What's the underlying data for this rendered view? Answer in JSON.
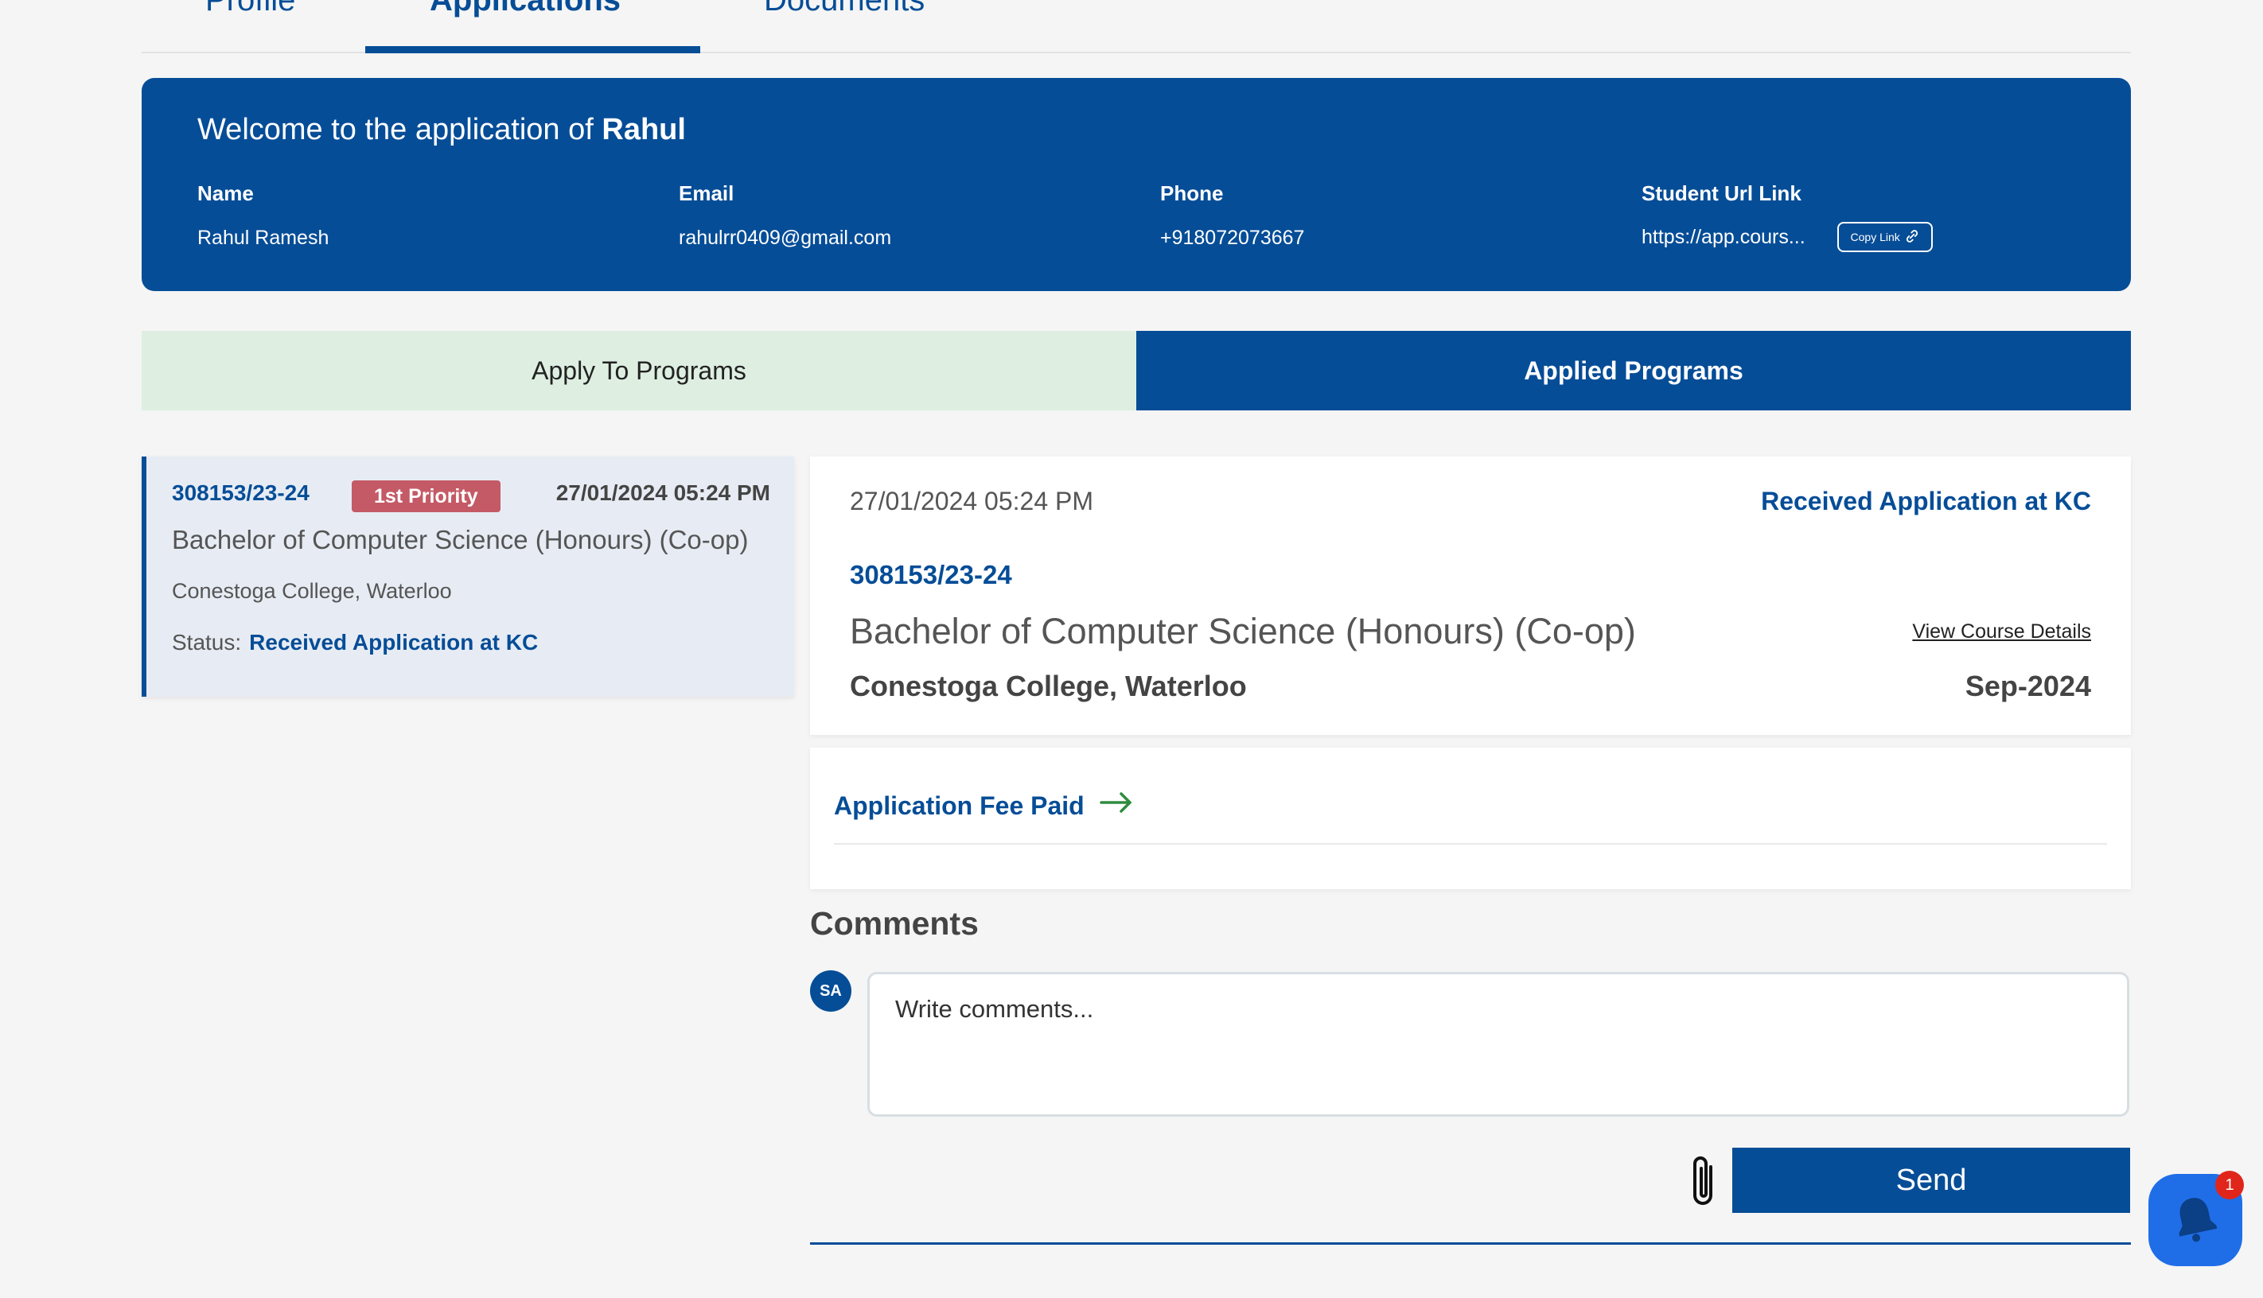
{
  "top_tabs": {
    "profile": "Profile",
    "applications": "Applications",
    "documents": "Documents",
    "active": "applications"
  },
  "welcome": {
    "prefix": "Welcome to the application of",
    "student_name": "Rahul",
    "fields": {
      "name_label": "Name",
      "name_value": "Rahul Ramesh",
      "email_label": "Email",
      "email_value": "rahulrr0409@gmail.com",
      "phone_label": "Phone",
      "phone_value": "+918072073667",
      "url_label": "Student Url Link",
      "url_value": "https://app.cours...",
      "copy_label": "Copy Link"
    }
  },
  "program_tabs": {
    "apply": "Apply To Programs",
    "applied": "Applied Programs",
    "active": "applied"
  },
  "application_card": {
    "id": "308153/23-24",
    "priority": "1st Priority",
    "date": "27/01/2024 05:24 PM",
    "program": "Bachelor of Computer Science (Honours) (Co-op)",
    "college": "Conestoga College, Waterloo",
    "status_label": "Status:",
    "status_value": "Received Application at KC"
  },
  "detail": {
    "date": "27/01/2024 05:24 PM",
    "status": "Received Application at KC",
    "id": "308153/23-24",
    "program": "Bachelor of Computer Science (Honours) (Co-op)",
    "view_link": "View Course Details",
    "college": "Conestoga College, Waterloo",
    "intake": "Sep-2024"
  },
  "fee": {
    "label": "Application Fee Paid",
    "icon": "arrow-right-icon"
  },
  "comments": {
    "title": "Comments",
    "avatar_initials": "SA",
    "placeholder": "Write comments...",
    "send_label": "Send",
    "attach_icon": "paperclip-icon"
  },
  "notifications": {
    "count": "1",
    "icon": "bell-icon"
  },
  "colors": {
    "primary": "#064d97",
    "apply_tab_bg": "#deefe2",
    "priority_badge": "#c45a66",
    "notify_bg": "#1f6ee8",
    "badge_red": "#e0261b"
  }
}
